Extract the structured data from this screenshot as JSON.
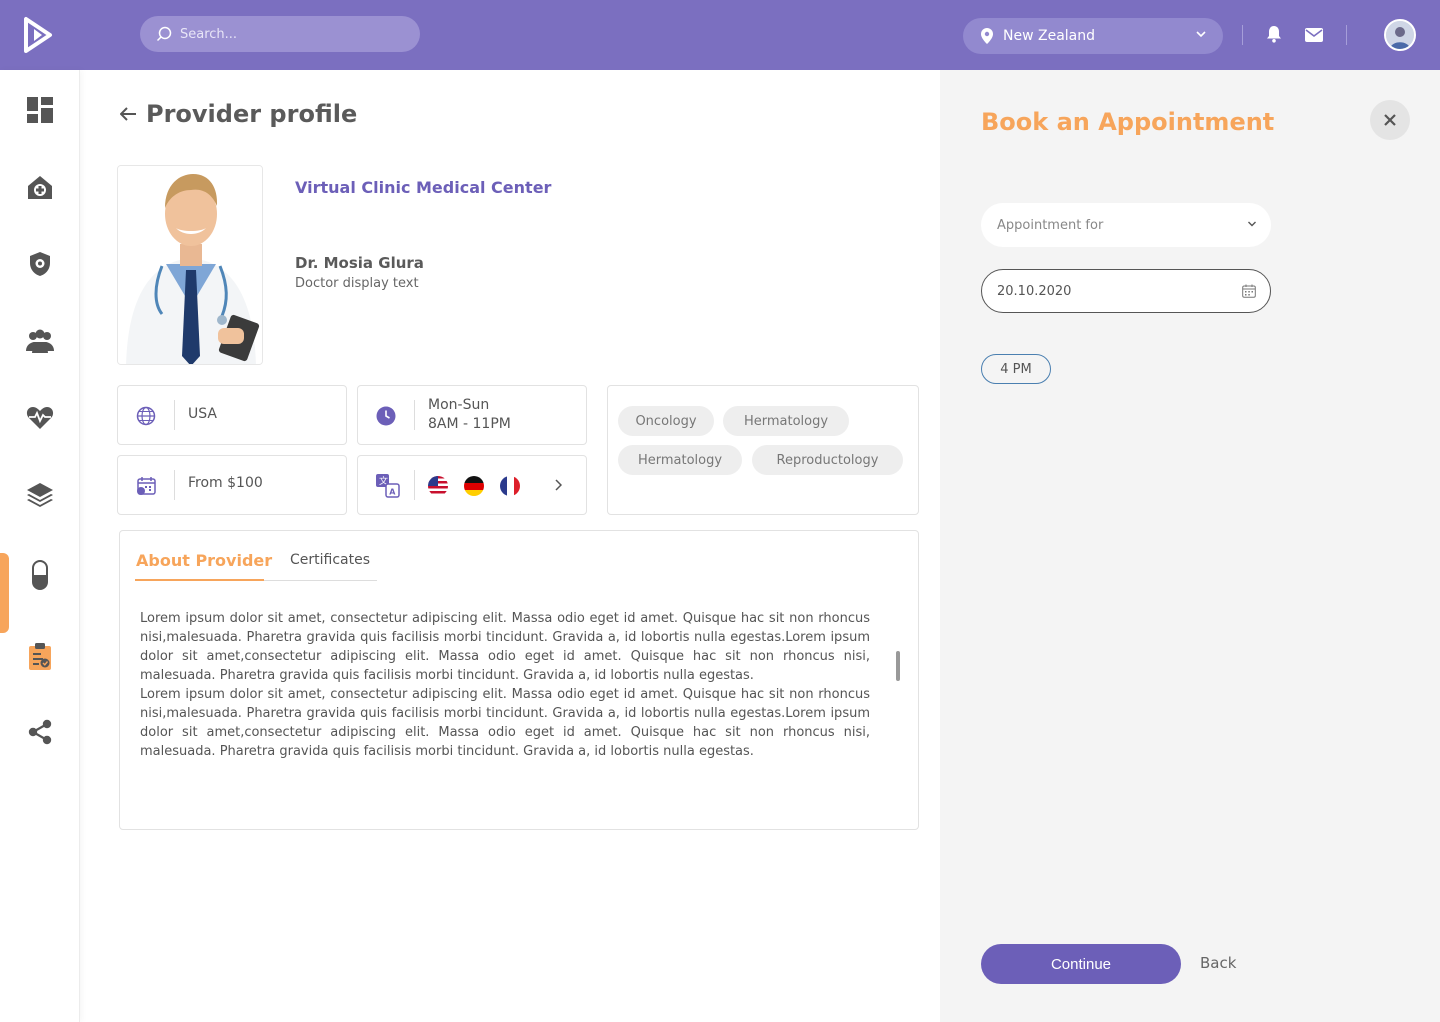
{
  "header": {
    "search_placeholder": "Search...",
    "location": "New Zealand"
  },
  "page": {
    "title": "Provider profile"
  },
  "provider": {
    "clinic": "Virtual Clinic Medical Center",
    "name": "Dr. Mosia Glura",
    "subtitle": "Doctor display text",
    "country": "USA",
    "hours_days": "Mon-Sun",
    "hours_time": "8AM - 11PM",
    "price": "From $100",
    "specialties": [
      "Oncology",
      "Hermatology",
      "Hermatology",
      "Reproductology"
    ]
  },
  "tabs": {
    "about": "About Provider",
    "certificates": "Certificates"
  },
  "about_text": [
    "Lorem ipsum dolor sit amet, consectetur adipiscing elit. Massa odio eget id amet. Quisque hac sit non rhoncus nisi,malesuada. Pharetra gravida quis facilisis morbi tincidunt. Gravida a, id lobortis nulla egestas.Lorem ipsum dolor sit amet,consectetur adipiscing elit. Massa odio eget id amet. Quisque hac sit non rhoncus nisi, malesuada. Pharetra gravida quis facilisis morbi tincidunt. Gravida a, id lobortis nulla egestas.",
    "Lorem ipsum dolor sit amet, consectetur adipiscing elit. Massa odio eget id amet. Quisque hac sit non rhoncus nisi,malesuada. Pharetra gravida quis facilisis morbi tincidunt. Gravida a, id lobortis nulla egestas.Lorem ipsum dolor sit amet,consectetur adipiscing elit. Massa odio eget id amet. Quisque hac sit non rhoncus nisi, malesuada. Pharetra gravida quis facilisis morbi tincidunt. Gravida a, id lobortis nulla egestas."
  ],
  "booking": {
    "title": "Book an Appointment",
    "appointment_for_placeholder": "Appointment for",
    "date": "20.10.2020",
    "time": "4 PM",
    "continue": "Continue",
    "back": "Back"
  },
  "colors": {
    "primary": "#7b6fc0",
    "accent": "#f7a55b",
    "button": "#6c5fb8"
  },
  "icons": {
    "sidebar": [
      "dashboard-icon",
      "hospital-icon",
      "shield-icon",
      "users-icon",
      "heart-pulse-icon",
      "layers-icon",
      "pill-icon",
      "clipboard-icon",
      "share-icon"
    ],
    "languages": [
      "usa-flag-icon",
      "germany-flag-icon",
      "france-flag-icon"
    ]
  }
}
